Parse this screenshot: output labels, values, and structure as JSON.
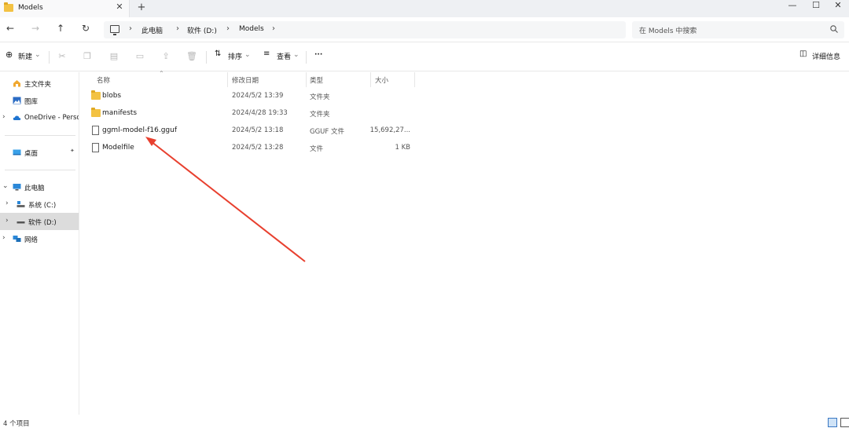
{
  "window": {
    "tab_title": "Models",
    "tab_close": "✕",
    "new_tab": "+",
    "minimize": "—",
    "maximize": "☐",
    "close": "✕"
  },
  "nav": {
    "back": "←",
    "forward": "→",
    "up": "↑",
    "refresh": "↻",
    "breadcrumb": [
      "此电脑",
      "软件 (D:)",
      "Models"
    ],
    "separator": "›",
    "search_placeholder": "在 Models 中搜索"
  },
  "toolbar": {
    "new_label": "新建",
    "sort_label": "排序",
    "view_label": "查看",
    "more_label": "···",
    "details_label": "详细信息"
  },
  "sidebar": {
    "items": [
      {
        "label": "主文件夹",
        "icon": "home-icon"
      },
      {
        "label": "图库",
        "icon": "gallery-icon"
      },
      {
        "label": "OneDrive - Personal",
        "icon": "cloud-icon"
      },
      {
        "label": "桌面",
        "icon": "desktop-icon",
        "pin": "📌"
      },
      {
        "label": "此电脑",
        "icon": "pc-icon"
      },
      {
        "label": "系统 (C:)",
        "icon": "drive-icon"
      },
      {
        "label": "软件 (D:)",
        "icon": "drive-icon"
      },
      {
        "label": "网络",
        "icon": "network-icon"
      }
    ]
  },
  "columns": {
    "name": "名称",
    "modified": "修改日期",
    "type": "类型",
    "size": "大小"
  },
  "files": [
    {
      "name": "blobs",
      "modified": "2024/5/2 13:39",
      "type": "文件夹",
      "size": "",
      "icon": "folder-icon"
    },
    {
      "name": "manifests",
      "modified": "2024/4/28 19:33",
      "type": "文件夹",
      "size": "",
      "icon": "folder-icon"
    },
    {
      "name": "ggml-model-f16.gguf",
      "modified": "2024/5/2 13:18",
      "type": "GGUF 文件",
      "size": "15,692,27...",
      "icon": "file-icon"
    },
    {
      "name": "Modelfile",
      "modified": "2024/5/2 13:28",
      "type": "文件",
      "size": "1 KB",
      "icon": "file-icon"
    }
  ],
  "status": {
    "item_count": "4 个项目"
  },
  "colors": {
    "annotation_arrow": "#e8402f",
    "folder": "#f3c243",
    "selected_bg": "#dcdcdc"
  }
}
